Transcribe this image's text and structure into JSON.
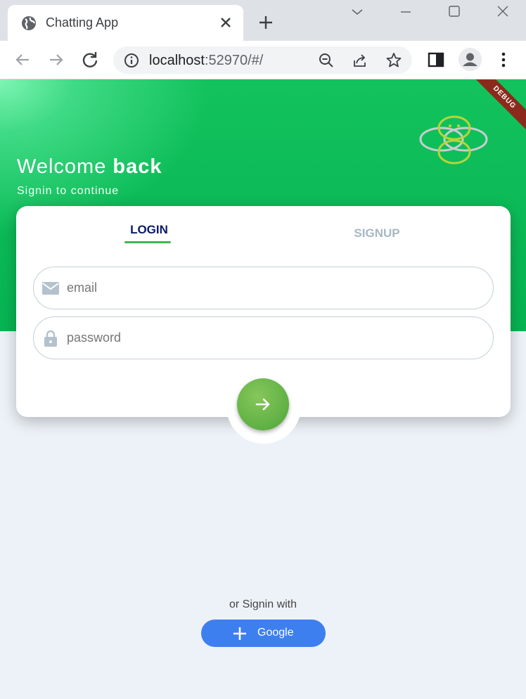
{
  "browser": {
    "tab_title": "Chatting App",
    "url_host": "localhost",
    "url_rest": ":52970/#/"
  },
  "app": {
    "debug_banner": "DEBUG",
    "welcome_prefix": "Welcome",
    "welcome_bold": "back",
    "subtitle": "Signin to continue",
    "tabs": [
      {
        "label": "LOGIN",
        "active": true
      },
      {
        "label": "SIGNUP",
        "active": false
      }
    ],
    "email": {
      "placeholder": "email",
      "value": ""
    },
    "password": {
      "placeholder": "password",
      "value": ""
    },
    "or_text": "or Signin with",
    "google_label": "Google"
  },
  "colors": {
    "accent_green": "#06b453",
    "button_green": "#5fb043",
    "google_blue": "#3e7ff0",
    "login_tab": "#0a1a6b",
    "inactive_tab": "#a7b8c3"
  },
  "icons": [
    "globe-icon",
    "close-icon",
    "plus-icon",
    "back-arrow-icon",
    "forward-arrow-icon",
    "reload-icon",
    "info-icon",
    "zoom-out-icon",
    "share-icon",
    "star-icon",
    "sidepanel-icon",
    "profile-icon",
    "more-icon",
    "mail-icon",
    "lock-icon",
    "arrow-right-icon",
    "app-logo"
  ]
}
